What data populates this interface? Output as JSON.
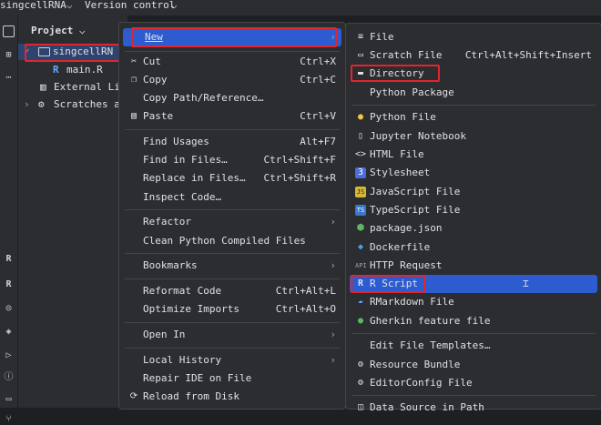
{
  "topbar": {
    "project": "singcellRNA",
    "vc": "Version control",
    "chev": "⌵"
  },
  "panel": {
    "title": "Project",
    "chev": "⌵"
  },
  "tree": {
    "root": "singcellRN",
    "file": "main.R",
    "ext": "External Li",
    "scratch": "Scratches a"
  },
  "context_menu": {
    "items": [
      {
        "label": "New",
        "arrow": "›"
      },
      {
        "label": "Cut",
        "shortcut": "Ctrl+X"
      },
      {
        "label": "Copy",
        "shortcut": "Ctrl+C"
      },
      {
        "label": "Copy Path/Reference…"
      },
      {
        "label": "Paste",
        "shortcut": "Ctrl+V"
      },
      {
        "label": "Find Usages",
        "shortcut": "Alt+F7"
      },
      {
        "label": "Find in Files…",
        "shortcut": "Ctrl+Shift+F"
      },
      {
        "label": "Replace in Files…",
        "shortcut": "Ctrl+Shift+R"
      },
      {
        "label": "Inspect Code…"
      },
      {
        "label": "Refactor",
        "arrow": "›"
      },
      {
        "label": "Clean Python Compiled Files"
      },
      {
        "label": "Bookmarks",
        "arrow": "›"
      },
      {
        "label": "Reformat Code",
        "shortcut": "Ctrl+Alt+L"
      },
      {
        "label": "Optimize Imports",
        "shortcut": "Ctrl+Alt+O"
      },
      {
        "label": "Open In",
        "arrow": "›"
      },
      {
        "label": "Local History",
        "arrow": "›"
      },
      {
        "label": "Repair IDE on File"
      },
      {
        "label": "Reload from Disk"
      }
    ]
  },
  "new_submenu": {
    "items": [
      {
        "label": "File"
      },
      {
        "label": "Scratch File",
        "shortcut": "Ctrl+Alt+Shift+Insert"
      },
      {
        "label": "Directory"
      },
      {
        "label": "Python Package"
      },
      {
        "label": "Python File"
      },
      {
        "label": "Jupyter Notebook"
      },
      {
        "label": "HTML File"
      },
      {
        "label": "Stylesheet"
      },
      {
        "label": "JavaScript File"
      },
      {
        "label": "TypeScript File"
      },
      {
        "label": "package.json"
      },
      {
        "label": "Dockerfile"
      },
      {
        "label": "HTTP Request"
      },
      {
        "label": "R Script"
      },
      {
        "label": "RMarkdown File"
      },
      {
        "label": "Gherkin feature file"
      },
      {
        "label": "Edit File Templates…"
      },
      {
        "label": "Resource Bundle"
      },
      {
        "label": "EditorConfig File"
      },
      {
        "label": "Data Source in Path"
      }
    ]
  },
  "icons": {
    "api": "API",
    "ts": "TS",
    "js": "JS",
    "css": "3",
    "r": "R"
  },
  "colors": {
    "accent": "#2d5bd0",
    "selection": "#2e436e",
    "annotation": "#e0262e",
    "bg": "#2b2d30"
  }
}
